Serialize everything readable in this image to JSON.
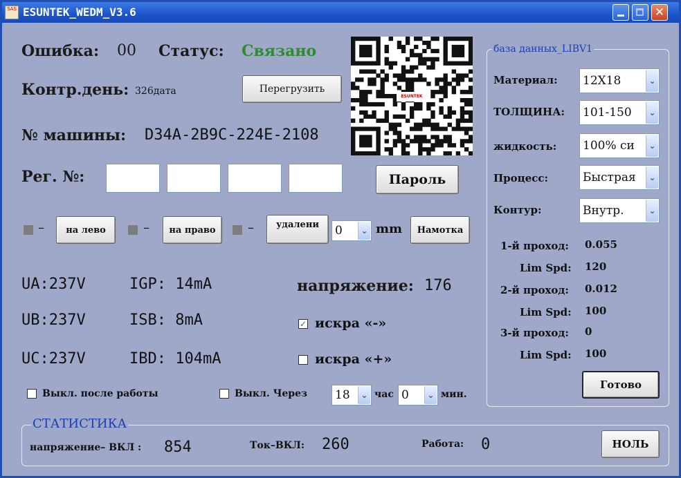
{
  "window": {
    "title": "ESUNTEK_WEDM_V3.6",
    "app_icon_text": "SAS"
  },
  "status": {
    "error_label": "Ошибка:",
    "error_value": "00",
    "status_label": "Статус:",
    "status_value": "Связано",
    "status_color": "#2e8b2e"
  },
  "control_day": {
    "label": "Контр.день:",
    "value": "326дата"
  },
  "reboot_button": "Перегрузить",
  "machine": {
    "label": "№ машины:",
    "value": "D34A-2B9C-224E-2108"
  },
  "registration": {
    "label": "Рег. №:",
    "fields": [
      "",
      "",
      "",
      ""
    ]
  },
  "password_button": "Пароль",
  "movement": {
    "left_button": "на лево",
    "right_button": "на право",
    "remove_button": "удалени",
    "offset_value": "0",
    "unit": "mm",
    "winding_button": "Намотка",
    "dash": "–"
  },
  "measurements": {
    "ua": "UA:237V",
    "ub": "UB:237V",
    "uc": "UC:237V",
    "igp": "IGP: 14mA",
    "isb": "ISB: 8mA",
    "ibd": "IBD: 104mA",
    "voltage_label": "напряжение:",
    "voltage_value": "176"
  },
  "spark": {
    "minus_label": "искра «-»",
    "minus_checked": true,
    "plus_label": "искра «+»",
    "plus_checked": false
  },
  "shutdown": {
    "after_work_label": "Выкл. после работы",
    "after_work_checked": false,
    "timer_label": "Выкл. Через",
    "timer_checked": false,
    "hours_value": "18",
    "hours_unit": "час",
    "minutes_value": "0",
    "minutes_unit": "мин."
  },
  "database": {
    "title": "база данных_LIBV1",
    "material_label": "Материал:",
    "material_value": "12X18",
    "thickness_label": "ТОЛЩИНА:",
    "thickness_value": "101-150",
    "fluid_label": "жидкость:",
    "fluid_value": "100% си",
    "process_label": "Процесс:",
    "process_value": "Быстрая",
    "contour_label": "Контур:",
    "contour_value": "Внутр.",
    "pass1_label": "1-й проход:",
    "pass1_value": "0.055",
    "lim1_label": "Lim Spd:",
    "lim1_value": "120",
    "pass2_label": "2-й проход:",
    "pass2_value": "0.012",
    "lim2_label": "Lim Spd:",
    "lim2_value": "100",
    "pass3_label": "3-й проход:",
    "pass3_value": "0",
    "lim3_label": "Lim Spd:",
    "lim3_value": "100",
    "ready_button": "Готово"
  },
  "statistics": {
    "title": "СТАТИСТИКА",
    "voltage_on_label": "напряжение– ВКЛ :",
    "voltage_on_value": "854",
    "current_on_label": "Ток–ВКЛ:",
    "current_on_value": "260",
    "work_label": "Работа:",
    "work_value": "0",
    "reset_button": "НОЛЬ"
  },
  "qr": {
    "center_text": "ESUNTEK"
  }
}
